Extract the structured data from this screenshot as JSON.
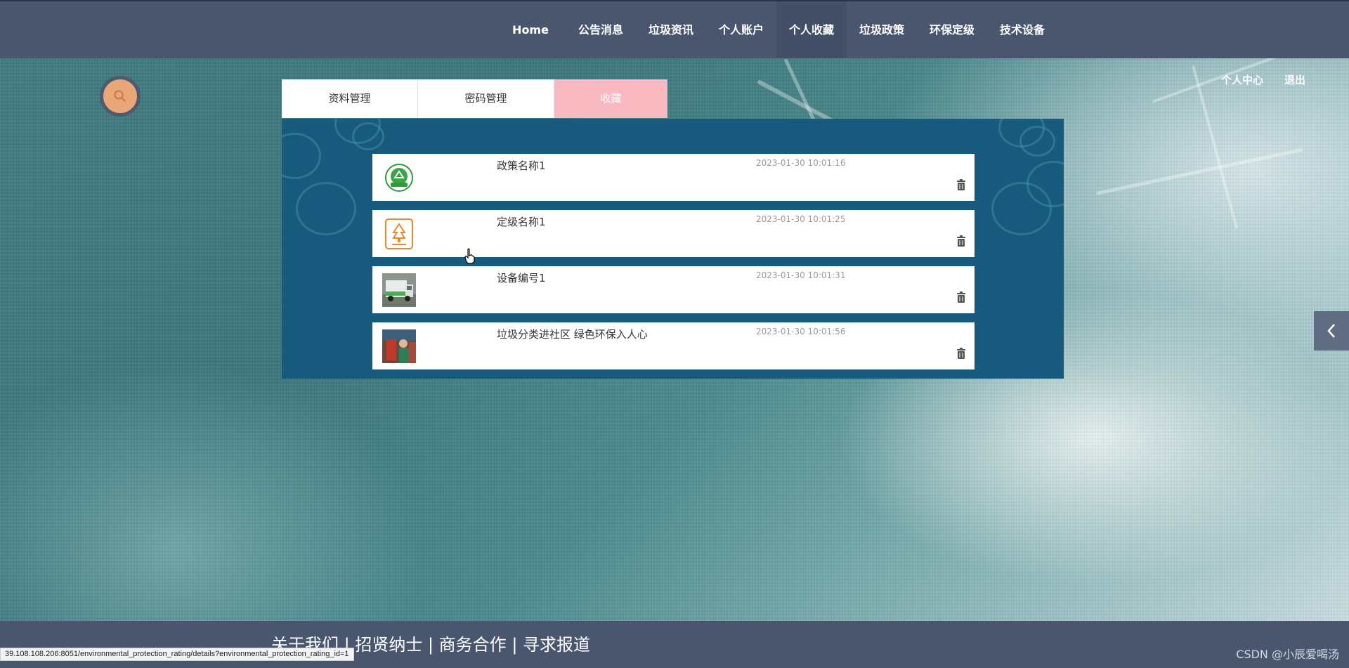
{
  "nav": {
    "items": [
      {
        "label": "Home",
        "active": false
      },
      {
        "label": "公告消息",
        "active": false
      },
      {
        "label": "垃圾资讯",
        "active": false
      },
      {
        "label": "个人账户",
        "active": false
      },
      {
        "label": "个人收藏",
        "active": true
      },
      {
        "label": "垃圾政策",
        "active": false
      },
      {
        "label": "环保定级",
        "active": false
      },
      {
        "label": "技术设备",
        "active": false
      }
    ]
  },
  "header_links": {
    "personal_center": "个人中心",
    "logout": "退出"
  },
  "tabs": [
    {
      "label": "资料管理",
      "active": false
    },
    {
      "label": "密码管理",
      "active": false
    },
    {
      "label": "收藏",
      "active": true
    }
  ],
  "favorites": [
    {
      "title": "政策名称1",
      "time": "2023-01-30 10:01:16",
      "icon": "recycle-badge-icon"
    },
    {
      "title": "定级名称1",
      "time": "2023-01-30 10:01:25",
      "icon": "eco-rating-badge-icon"
    },
    {
      "title": "设备编号1",
      "time": "2023-01-30 10:01:31",
      "icon": "garbage-truck-photo"
    },
    {
      "title": "垃圾分类进社区 绿色环保入人心",
      "time": "2023-01-30 10:01:56",
      "icon": "community-photo"
    }
  ],
  "footer": {
    "links": "关于我们 | 招贤纳士 | 商务合作 | 寻求报道"
  },
  "status_url": "39.108.108.206:8051/environmental_protection_rating/details?environmental_protection_rating_id=1",
  "watermark": "CSDN @小辰爱喝汤",
  "colors": {
    "nav_bg": "#4a566e",
    "panel_bg": "#185a7e",
    "active_tab": "#f9b9c0",
    "search_btn": "#e9a777"
  }
}
